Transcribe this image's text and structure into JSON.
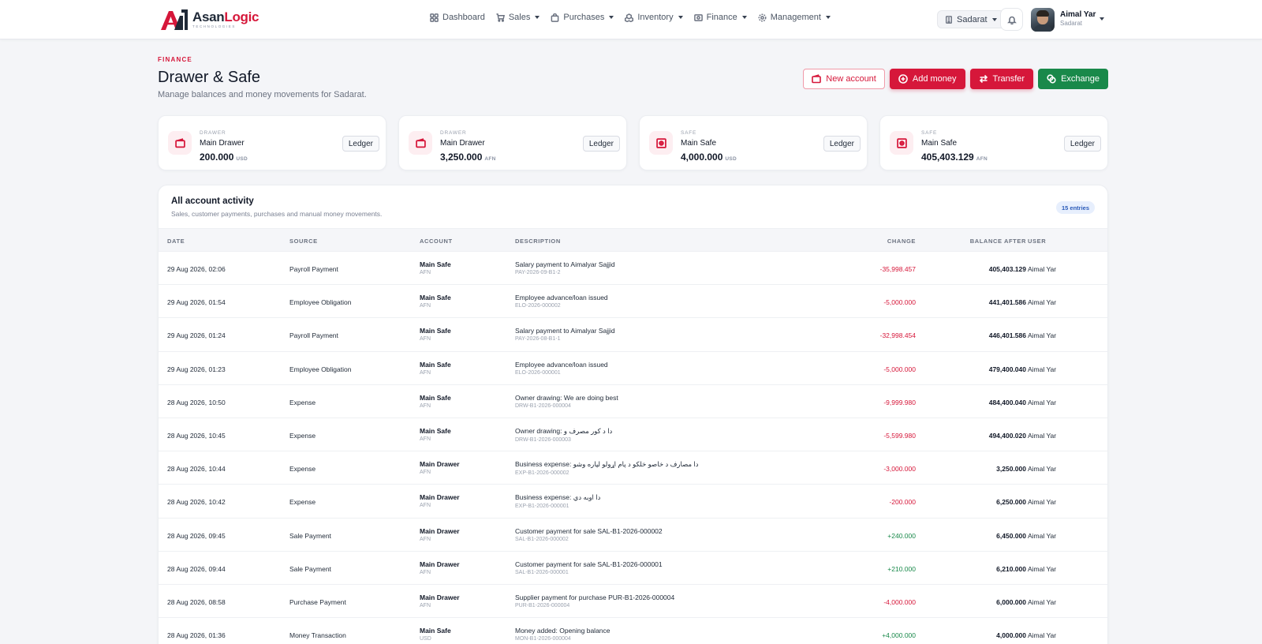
{
  "brand": {
    "name_part1": "Asan",
    "name_part2": "Logic",
    "tagline": "TECHNOLOGIES",
    "logo_text": "A"
  },
  "nav": {
    "items": [
      {
        "label": "Dashboard",
        "icon": "grid-icon",
        "has_caret": false
      },
      {
        "label": "Sales",
        "icon": "cart-icon",
        "has_caret": true
      },
      {
        "label": "Purchases",
        "icon": "bag-icon",
        "has_caret": true
      },
      {
        "label": "Inventory",
        "icon": "boxes-icon",
        "has_caret": true
      },
      {
        "label": "Finance",
        "icon": "money-icon",
        "has_caret": true
      },
      {
        "label": "Management",
        "icon": "gear-icon",
        "has_caret": true
      }
    ],
    "branch": "Sadarat",
    "user": {
      "name": "Aimal Yar",
      "branch": "Sadarat"
    }
  },
  "header": {
    "eyebrow": "FINANCE",
    "title": "Drawer & Safe",
    "subtitle": "Manage balances and money movements for Sadarat.",
    "actions": {
      "new_account": "New account",
      "add_money": "Add money",
      "transfer": "Transfer",
      "exchange": "Exchange"
    }
  },
  "accounts": [
    {
      "type": "DRAWER",
      "name": "Main Drawer",
      "amount": "200.000",
      "currency": "USD",
      "ledger": "Ledger",
      "icon": "wallet-icon"
    },
    {
      "type": "DRAWER",
      "name": "Main Drawer",
      "amount": "3,250.000",
      "currency": "AFN",
      "ledger": "Ledger",
      "icon": "wallet-icon"
    },
    {
      "type": "SAFE",
      "name": "Main Safe",
      "amount": "4,000.000",
      "currency": "USD",
      "ledger": "Ledger",
      "icon": "safe-icon"
    },
    {
      "type": "SAFE",
      "name": "Main Safe",
      "amount": "405,403.129",
      "currency": "AFN",
      "ledger": "Ledger",
      "icon": "safe-icon"
    }
  ],
  "activity": {
    "title": "All account activity",
    "subtitle": "Sales, customer payments, purchases and manual money movements.",
    "badge": "15 entries",
    "columns": {
      "date": "DATE",
      "source": "SOURCE",
      "account": "ACCOUNT",
      "description": "DESCRIPTION",
      "change": "CHANGE",
      "balance_after": "BALANCE AFTER",
      "user": "USER"
    },
    "rows": [
      {
        "date": "29 Aug 2026, 02:06",
        "source": "Payroll Payment",
        "account": "Main Safe",
        "currency": "AFN",
        "desc": "Salary payment to Aimalyar Sajjid",
        "ref": "PAY-2026-09-B1-2",
        "change": "-35,998.457",
        "sign": "neg",
        "balance": "405,403.129",
        "user": "Aimal Yar"
      },
      {
        "date": "29 Aug 2026, 01:54",
        "source": "Employee Obligation",
        "account": "Main Safe",
        "currency": "AFN",
        "desc": "Employee advance/loan issued",
        "ref": "ELO-2026-000002",
        "change": "-5,000.000",
        "sign": "neg",
        "balance": "441,401.586",
        "user": "Aimal Yar"
      },
      {
        "date": "29 Aug 2026, 01:24",
        "source": "Payroll Payment",
        "account": "Main Safe",
        "currency": "AFN",
        "desc": "Salary payment to Aimalyar Sajjid",
        "ref": "PAY-2026-08-B1-1",
        "change": "-32,998.454",
        "sign": "neg",
        "balance": "446,401.586",
        "user": "Aimal Yar"
      },
      {
        "date": "29 Aug 2026, 01:23",
        "source": "Employee Obligation",
        "account": "Main Safe",
        "currency": "AFN",
        "desc": "Employee advance/loan issued",
        "ref": "ELO-2026-000001",
        "change": "-5,000.000",
        "sign": "neg",
        "balance": "479,400.040",
        "user": "Aimal Yar"
      },
      {
        "date": "28 Aug 2026, 10:50",
        "source": "Expense",
        "account": "Main Safe",
        "currency": "AFN",
        "desc": "Owner drawing: We are doing best",
        "ref": "DRW-B1-2026-000004",
        "change": "-9,999.980",
        "sign": "neg",
        "balance": "484,400.040",
        "user": "Aimal Yar"
      },
      {
        "date": "28 Aug 2026, 10:45",
        "source": "Expense",
        "account": "Main Safe",
        "currency": "AFN",
        "desc": "Owner drawing: دا د کور مصرف و",
        "ref": "DRW-B1-2026-000003",
        "change": "-5,599.980",
        "sign": "neg",
        "balance": "494,400.020",
        "user": "Aimal Yar"
      },
      {
        "date": "28 Aug 2026, 10:44",
        "source": "Expense",
        "account": "Main Drawer",
        "currency": "AFN",
        "desc": "Business expense: دا مصارف د خاصو خلکو د پام اړولو لپاره وشو",
        "ref": "EXP-B1-2026-000002",
        "change": "-3,000.000",
        "sign": "neg",
        "balance": "3,250.000",
        "user": "Aimal Yar"
      },
      {
        "date": "28 Aug 2026, 10:42",
        "source": "Expense",
        "account": "Main Drawer",
        "currency": "AFN",
        "desc": "Business expense: دا اوبه دي",
        "ref": "EXP-B1-2026-000001",
        "change": "-200.000",
        "sign": "neg",
        "balance": "6,250.000",
        "user": "Aimal Yar"
      },
      {
        "date": "28 Aug 2026, 09:45",
        "source": "Sale Payment",
        "account": "Main Drawer",
        "currency": "AFN",
        "desc": "Customer payment for sale SAL-B1-2026-000002",
        "ref": "SAL-B1-2026-000002",
        "change": "+240.000",
        "sign": "pos",
        "balance": "6,450.000",
        "user": "Aimal Yar"
      },
      {
        "date": "28 Aug 2026, 09:44",
        "source": "Sale Payment",
        "account": "Main Drawer",
        "currency": "AFN",
        "desc": "Customer payment for sale SAL-B1-2026-000001",
        "ref": "SAL-B1-2026-000001",
        "change": "+210.000",
        "sign": "pos",
        "balance": "6,210.000",
        "user": "Aimal Yar"
      },
      {
        "date": "28 Aug 2026, 08:58",
        "source": "Purchase Payment",
        "account": "Main Drawer",
        "currency": "AFN",
        "desc": "Supplier payment for purchase PUR-B1-2026-000004",
        "ref": "PUR-B1-2026-000004",
        "change": "-4,000.000",
        "sign": "neg",
        "balance": "6,000.000",
        "user": "Aimal Yar"
      },
      {
        "date": "28 Aug 2026, 01:36",
        "source": "Money Transaction",
        "account": "Main Safe",
        "currency": "USD",
        "desc": "Money added: Opening balance",
        "ref": "MON-B1-2026-000004",
        "change": "+4,000.000",
        "sign": "pos",
        "balance": "4,000.000",
        "user": "Aimal Yar"
      }
    ]
  },
  "colors": {
    "accent": "#d6173a",
    "success": "#19894a",
    "badge_bg": "#e7effd",
    "badge_text": "#2b5bb8"
  }
}
